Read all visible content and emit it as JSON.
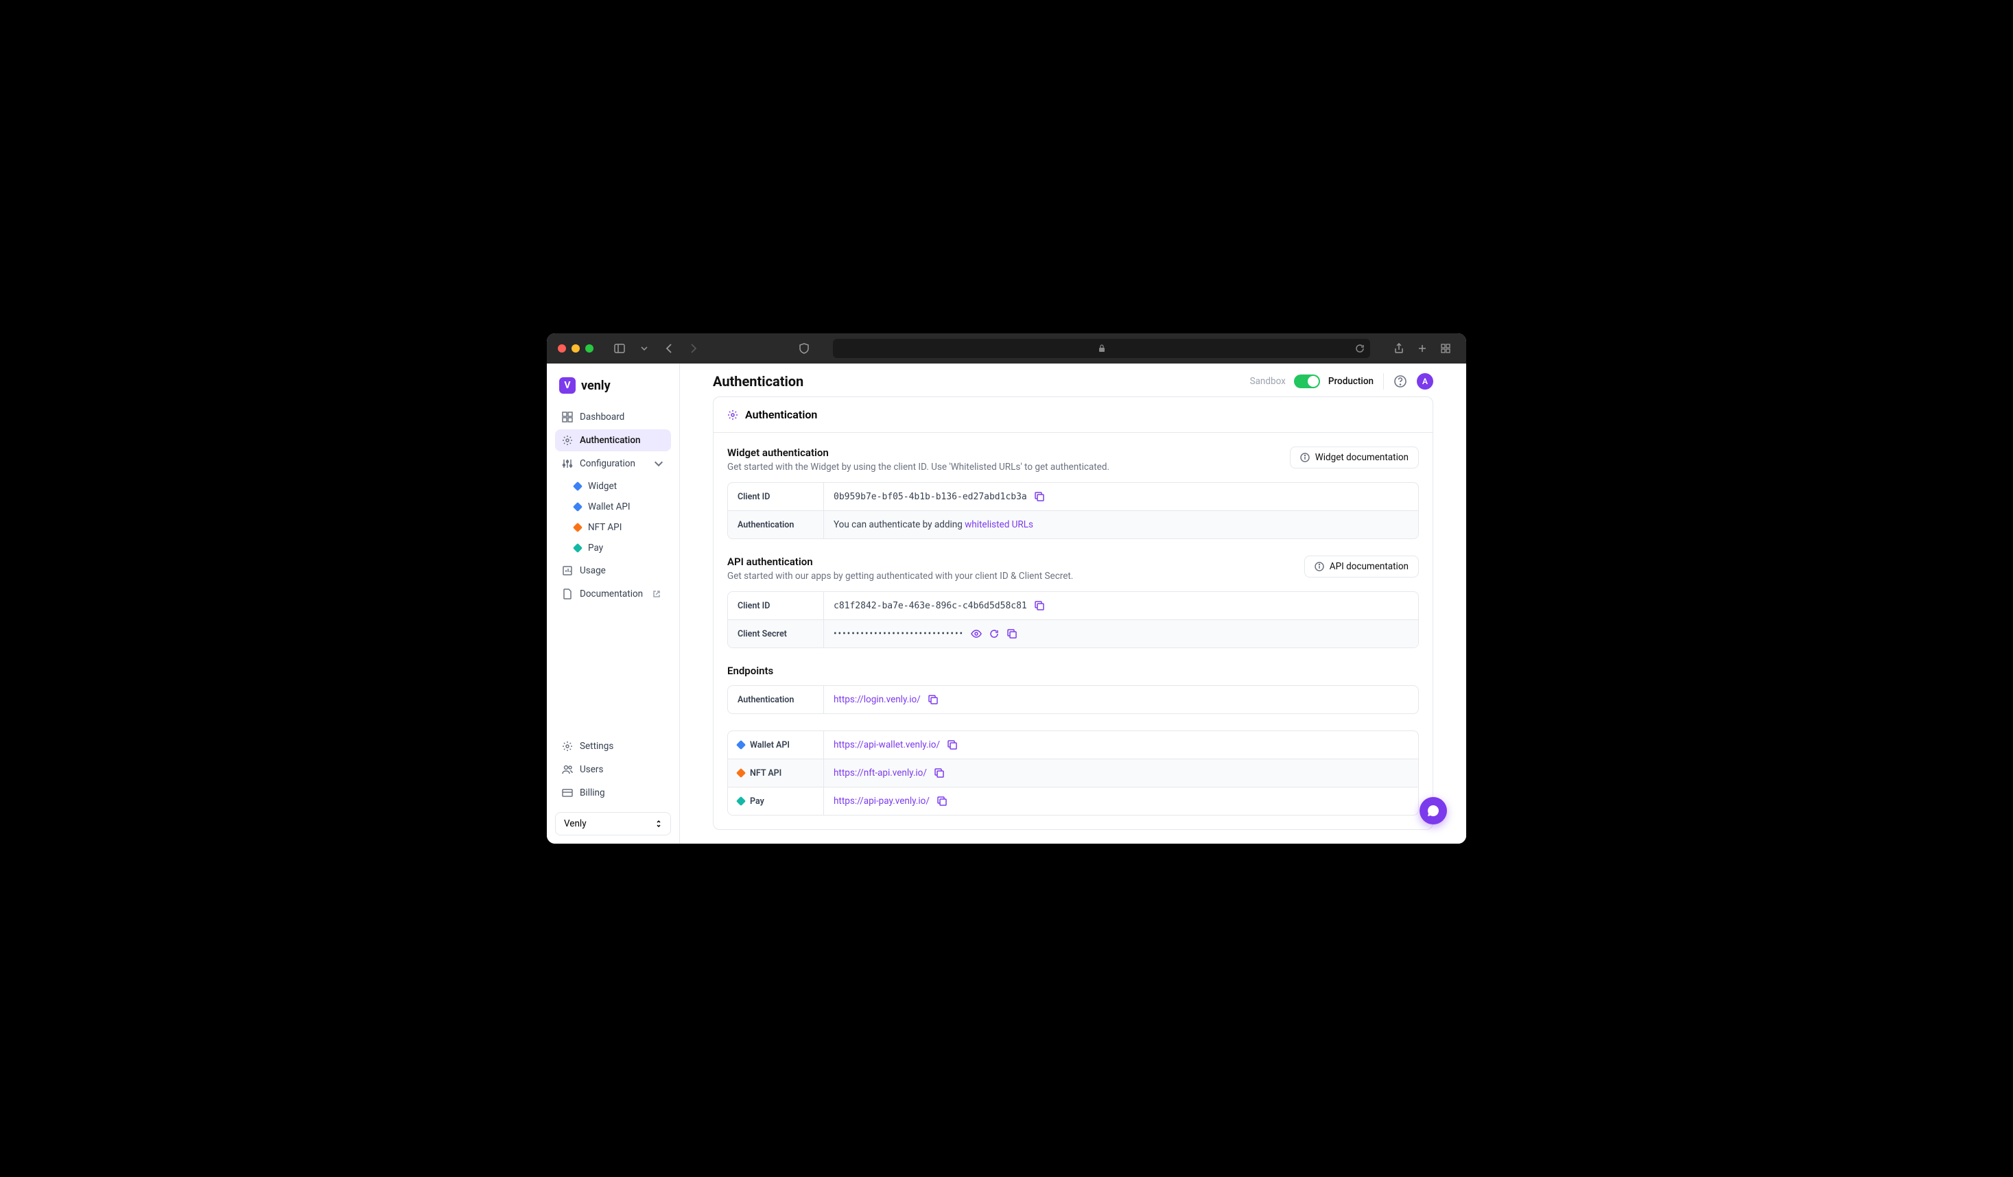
{
  "logo": {
    "text": "venly",
    "mark": "V"
  },
  "sidebar": {
    "items": [
      {
        "label": "Dashboard"
      },
      {
        "label": "Authentication"
      },
      {
        "label": "Configuration"
      },
      {
        "label": "Usage"
      },
      {
        "label": "Documentation"
      }
    ],
    "config_sub": [
      {
        "label": "Widget"
      },
      {
        "label": "Wallet API"
      },
      {
        "label": "NFT API"
      },
      {
        "label": "Pay"
      }
    ],
    "bottom": [
      {
        "label": "Settings"
      },
      {
        "label": "Users"
      },
      {
        "label": "Billing"
      }
    ],
    "org": "Venly"
  },
  "header": {
    "title": "Authentication",
    "sandbox": "Sandbox",
    "production": "Production",
    "avatar": "A"
  },
  "card_title": "Authentication",
  "widget": {
    "title": "Widget authentication",
    "desc": "Get started with the Widget by using the client ID. Use 'Whitelisted URLs' to get authenticated.",
    "doc_btn": "Widget documentation",
    "rows": {
      "client_id_label": "Client ID",
      "client_id": "0b959b7e-bf05-4b1b-b136-ed27abd1cb3a",
      "auth_label": "Authentication",
      "auth_prefix": "You can authenticate by adding ",
      "auth_link": "whitelisted URLs"
    }
  },
  "api": {
    "title": "API authentication",
    "desc": "Get started with our apps by getting authenticated with your client ID & Client Secret.",
    "doc_btn": "API documentation",
    "rows": {
      "client_id_label": "Client ID",
      "client_id": "c81f2842-ba7e-463e-896c-c4b6d5d58c81",
      "secret_label": "Client Secret",
      "secret": "•••••••••••••••••••••••••••••"
    }
  },
  "endpoints": {
    "title": "Endpoints",
    "rows": [
      {
        "label": "Authentication",
        "url": "https://login.venly.io/",
        "icon": null
      },
      {
        "label": "Wallet API",
        "url": "https://api-wallet.venly.io/",
        "icon": "blue"
      },
      {
        "label": "NFT API",
        "url": "https://nft-api.venly.io/",
        "icon": "orange"
      },
      {
        "label": "Pay",
        "url": "https://api-pay.venly.io/",
        "icon": "teal"
      }
    ]
  }
}
